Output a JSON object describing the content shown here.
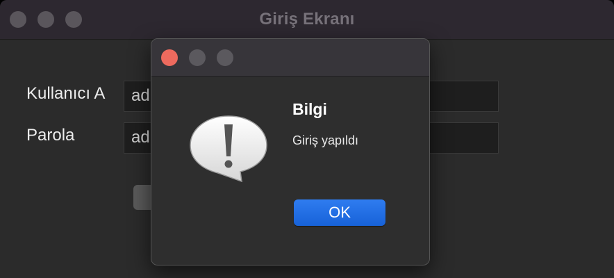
{
  "main_window": {
    "title": "Giriş Ekranı",
    "username_label": "Kullanıcı A",
    "username_value": "ad",
    "password_label": "Parola",
    "password_value": "ad"
  },
  "dialog": {
    "icon": "alert-exclamation-icon",
    "title": "Bilgi",
    "message": "Giriş yapıldı",
    "ok_label": "OK"
  },
  "colors": {
    "ok_button": "#1e6ae3",
    "close_button": "#ed6a5e",
    "window_bg": "#2b2b2b"
  }
}
